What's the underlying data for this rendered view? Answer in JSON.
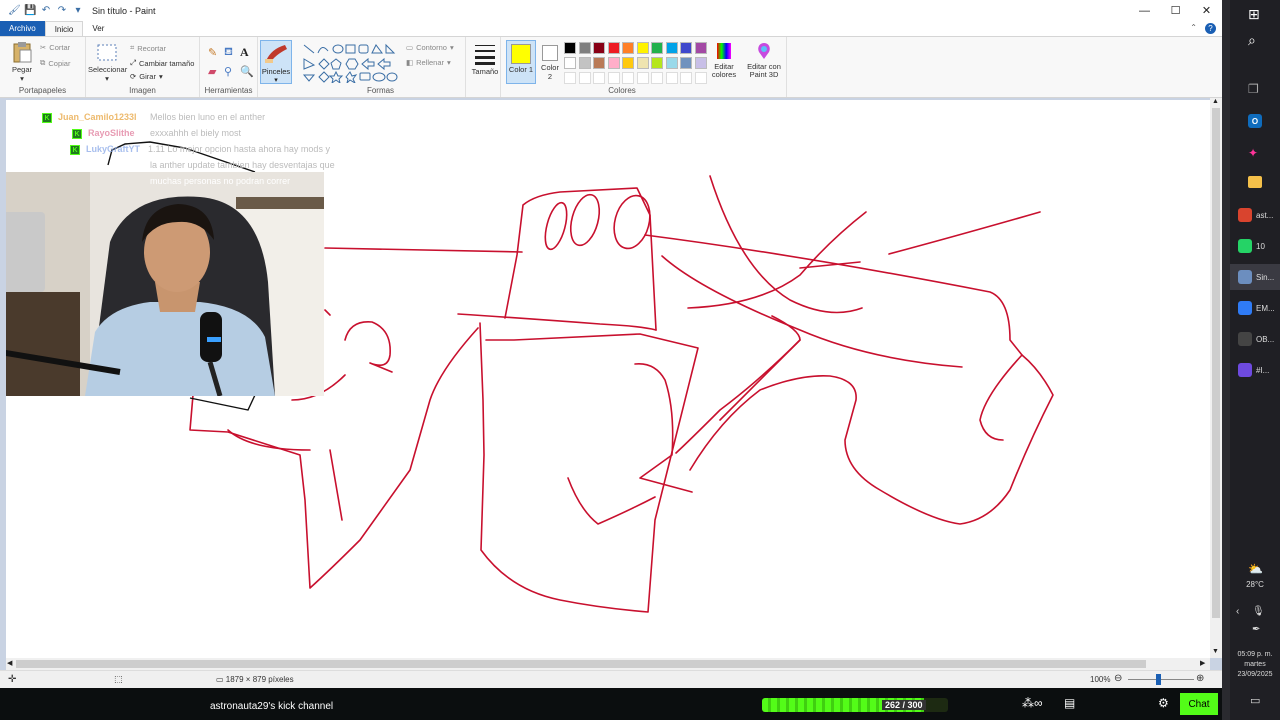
{
  "window": {
    "title": "Sin título - Paint",
    "minimize": "—",
    "maximize": "☐",
    "close": "✕"
  },
  "menu": {
    "file": "Archivo",
    "home": "Inicio",
    "view": "Ver"
  },
  "ribbon": {
    "clipboard": {
      "label": "Portapapeles",
      "paste": "Pegar",
      "cut": "Cortar",
      "copy": "Copiar"
    },
    "image": {
      "label": "Imagen",
      "select": "Seleccionar",
      "crop": "Recortar",
      "resize": "Cambiar tamaño",
      "rotate": "Girar"
    },
    "tools": {
      "label": "Herramientas"
    },
    "brushes": {
      "label": "Pinceles"
    },
    "shapes": {
      "label": "Formas",
      "outline": "Contorno",
      "fill": "Rellenar"
    },
    "size": {
      "label": "Tamaño"
    },
    "color1": {
      "label": "Color 1",
      "value": "#ffff00"
    },
    "color2": {
      "label": "Color 2",
      "value": "#ffffff"
    },
    "colors": {
      "label": "Colores",
      "edit": "Editar colores",
      "paint3d": "Editar con Paint 3D",
      "palette_row1": [
        "#000000",
        "#7f7f7f",
        "#880015",
        "#ed1c24",
        "#ff7f27",
        "#fff200",
        "#22b14c",
        "#00a2e8",
        "#3f48cc",
        "#a349a4"
      ],
      "palette_row2": [
        "#ffffff",
        "#c3c3c3",
        "#b97a57",
        "#ffaec9",
        "#ffc90e",
        "#efe4b0",
        "#b5e61d",
        "#99d9ea",
        "#7092be",
        "#c8bfe7"
      ]
    }
  },
  "status": {
    "dimensions": "1879 × 879 píxeles",
    "zoom": "100%"
  },
  "chat": [
    {
      "user": "Juan_Camilo1233l",
      "message": "Mellos bien luno en el anther",
      "color": "#e8a33d"
    },
    {
      "user": "RayoSlithe",
      "message": "exxxahhh el biely most",
      "color": "#e07a9a"
    },
    {
      "user": "LukyGraftYT",
      "message": "1.11 Lo mejor opcion hasta ahora hay mods y",
      "color": "#8aa9e8"
    }
  ],
  "chat_continuation": [
    "la anther update tambien hay desventajas que",
    "muchas personas no podran correr"
  ],
  "stream": {
    "channel": "astronauta29's kick channel",
    "progress_text": "262 / 300",
    "progress": 0.873,
    "chat_button": "Chat"
  },
  "taskbar": {
    "items": [
      {
        "name": "ast...",
        "color": "#d9442e"
      },
      {
        "name": "10",
        "color": "#25d366"
      },
      {
        "name": "Sin...",
        "color": "#6c8ebf"
      },
      {
        "name": "EM...",
        "color": "#2f7bf5"
      },
      {
        "name": "OB...",
        "color": "#444444"
      },
      {
        "name": "#I...",
        "color": "#6e4ae0"
      }
    ],
    "weather": "28°C",
    "time": "05:09 p. m.",
    "day": "martes",
    "date": "23/09/2025"
  }
}
